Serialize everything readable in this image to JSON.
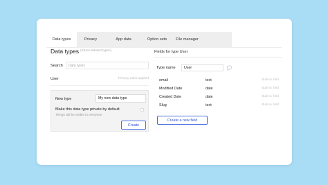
{
  "tabs": [
    {
      "label": "Data types",
      "active": true
    },
    {
      "label": "Privacy",
      "active": false
    },
    {
      "label": "App data",
      "active": false
    },
    {
      "label": "Option sets",
      "active": false
    },
    {
      "label": "File manager",
      "active": false
    }
  ],
  "left": {
    "title": "Data types",
    "show_deleted": "(Show deleted types)",
    "search_label": "Search",
    "search_placeholder": "Data types",
    "user_row": {
      "name": "User",
      "note": "Privacy rules applied"
    },
    "new_type": {
      "label": "New type",
      "value": "My new data type",
      "private_label": "Make this data type private by default",
      "private_note": "Things will be visible to everyone",
      "private_checked": false,
      "create_label": "Create"
    }
  },
  "right": {
    "title": "Fields for type User",
    "type_name_label": "Type name",
    "type_name_value": "User",
    "fields": [
      {
        "name": "email",
        "type": "text",
        "note": "Built-in field"
      },
      {
        "name": "Modified Date",
        "type": "date",
        "note": "Built-in field"
      },
      {
        "name": "Created Date",
        "type": "date",
        "note": "Built-in field"
      },
      {
        "name": "Slug",
        "type": "text",
        "note": "Built-in field"
      }
    ],
    "create_field_label": "Create a new field"
  },
  "colors": {
    "background": "#a9dcf5",
    "accent": "#2e55d4",
    "tab_bar": "#eeeeee"
  },
  "icons": {
    "comment": "chat-bubble-icon"
  }
}
